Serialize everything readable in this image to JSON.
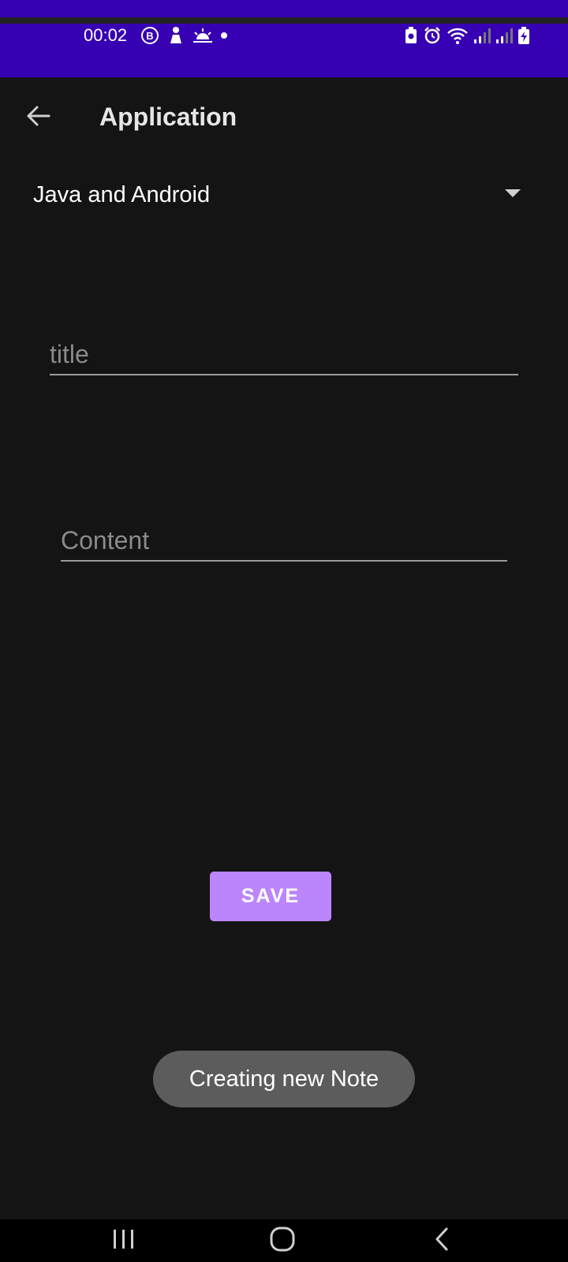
{
  "status_bar": {
    "time": "00:02",
    "left_icons": [
      "b-circle-icon",
      "person-notification-icon",
      "sunrise-icon",
      "dot-icon"
    ],
    "right_icons": [
      "battery-saver-icon",
      "alarm-icon",
      "wifi-icon",
      "signal-1-icon",
      "signal-2-icon",
      "battery-charging-icon"
    ],
    "background": "#3700b3"
  },
  "toolbar": {
    "back_icon": "arrow-back-icon",
    "title": "Application"
  },
  "spinner": {
    "selected": "Java and Android",
    "icon": "dropdown-arrow-icon"
  },
  "form": {
    "title_placeholder": "title",
    "title_value": "",
    "content_placeholder": "Content",
    "content_value": ""
  },
  "save_button": {
    "label": "SAVE",
    "color": "#bb86fc"
  },
  "toast": {
    "text": "Creating new Note"
  },
  "nav_bar": {
    "icons": [
      "recents-icon",
      "home-icon",
      "back-icon"
    ]
  }
}
